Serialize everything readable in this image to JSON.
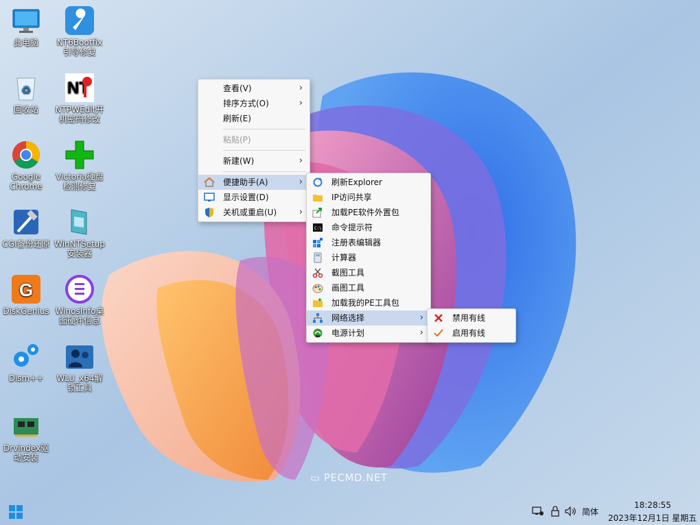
{
  "desktop": {
    "icons": [
      {
        "label": "此电脑"
      },
      {
        "label": "NT6Bootfix\n引导修复"
      },
      {
        "label": "回收站"
      },
      {
        "label": "NTPWEdit开\n机密码修改"
      },
      {
        "label": "Google\nChrome"
      },
      {
        "label": "Victoria硬盘\n检测修复"
      },
      {
        "label": "CGI备份还原"
      },
      {
        "label": "WinNTSetup\n安装器"
      },
      {
        "label": "DiskGenius"
      },
      {
        "label": "WinosInfo桌\n面硬件信息"
      },
      {
        "label": "Dism++"
      },
      {
        "label": "WLU_x64解\n锁工具"
      },
      {
        "label": "Drvindex驱\n动安装"
      }
    ],
    "nt_logo_text": "NT",
    "watermark": "PECMD.NET"
  },
  "context_menu": {
    "items": [
      {
        "label": "查看(V)"
      },
      {
        "label": "排序方式(O)"
      },
      {
        "label": "刷新(E)"
      },
      {
        "label": "粘贴(P)"
      },
      {
        "label": "新建(W)"
      },
      {
        "label": "便捷助手(A)"
      },
      {
        "label": "显示设置(D)"
      },
      {
        "label": "关机或重启(U)"
      }
    ]
  },
  "helper_menu": {
    "items": [
      {
        "label": "刷新Explorer"
      },
      {
        "label": "IP访问共享"
      },
      {
        "label": "加载PE软件外置包"
      },
      {
        "label": "命令提示符"
      },
      {
        "label": "注册表编辑器"
      },
      {
        "label": "计算器"
      },
      {
        "label": "截图工具"
      },
      {
        "label": "画图工具"
      },
      {
        "label": "加载我的PE工具包"
      },
      {
        "label": "网络选择"
      },
      {
        "label": "电源计划"
      }
    ]
  },
  "network_menu": {
    "items": [
      {
        "label": "禁用有线"
      },
      {
        "label": "启用有线"
      }
    ]
  },
  "taskbar": {
    "ime_label": "简体",
    "time": "18:28:55",
    "date": "2023年12月1日 星期五"
  },
  "colors": {
    "menu_highlight": "#c9d8ee",
    "disabled_text": "#9a9a9a",
    "disable_red": "#d42323",
    "enable_orange": "#e0701c"
  }
}
